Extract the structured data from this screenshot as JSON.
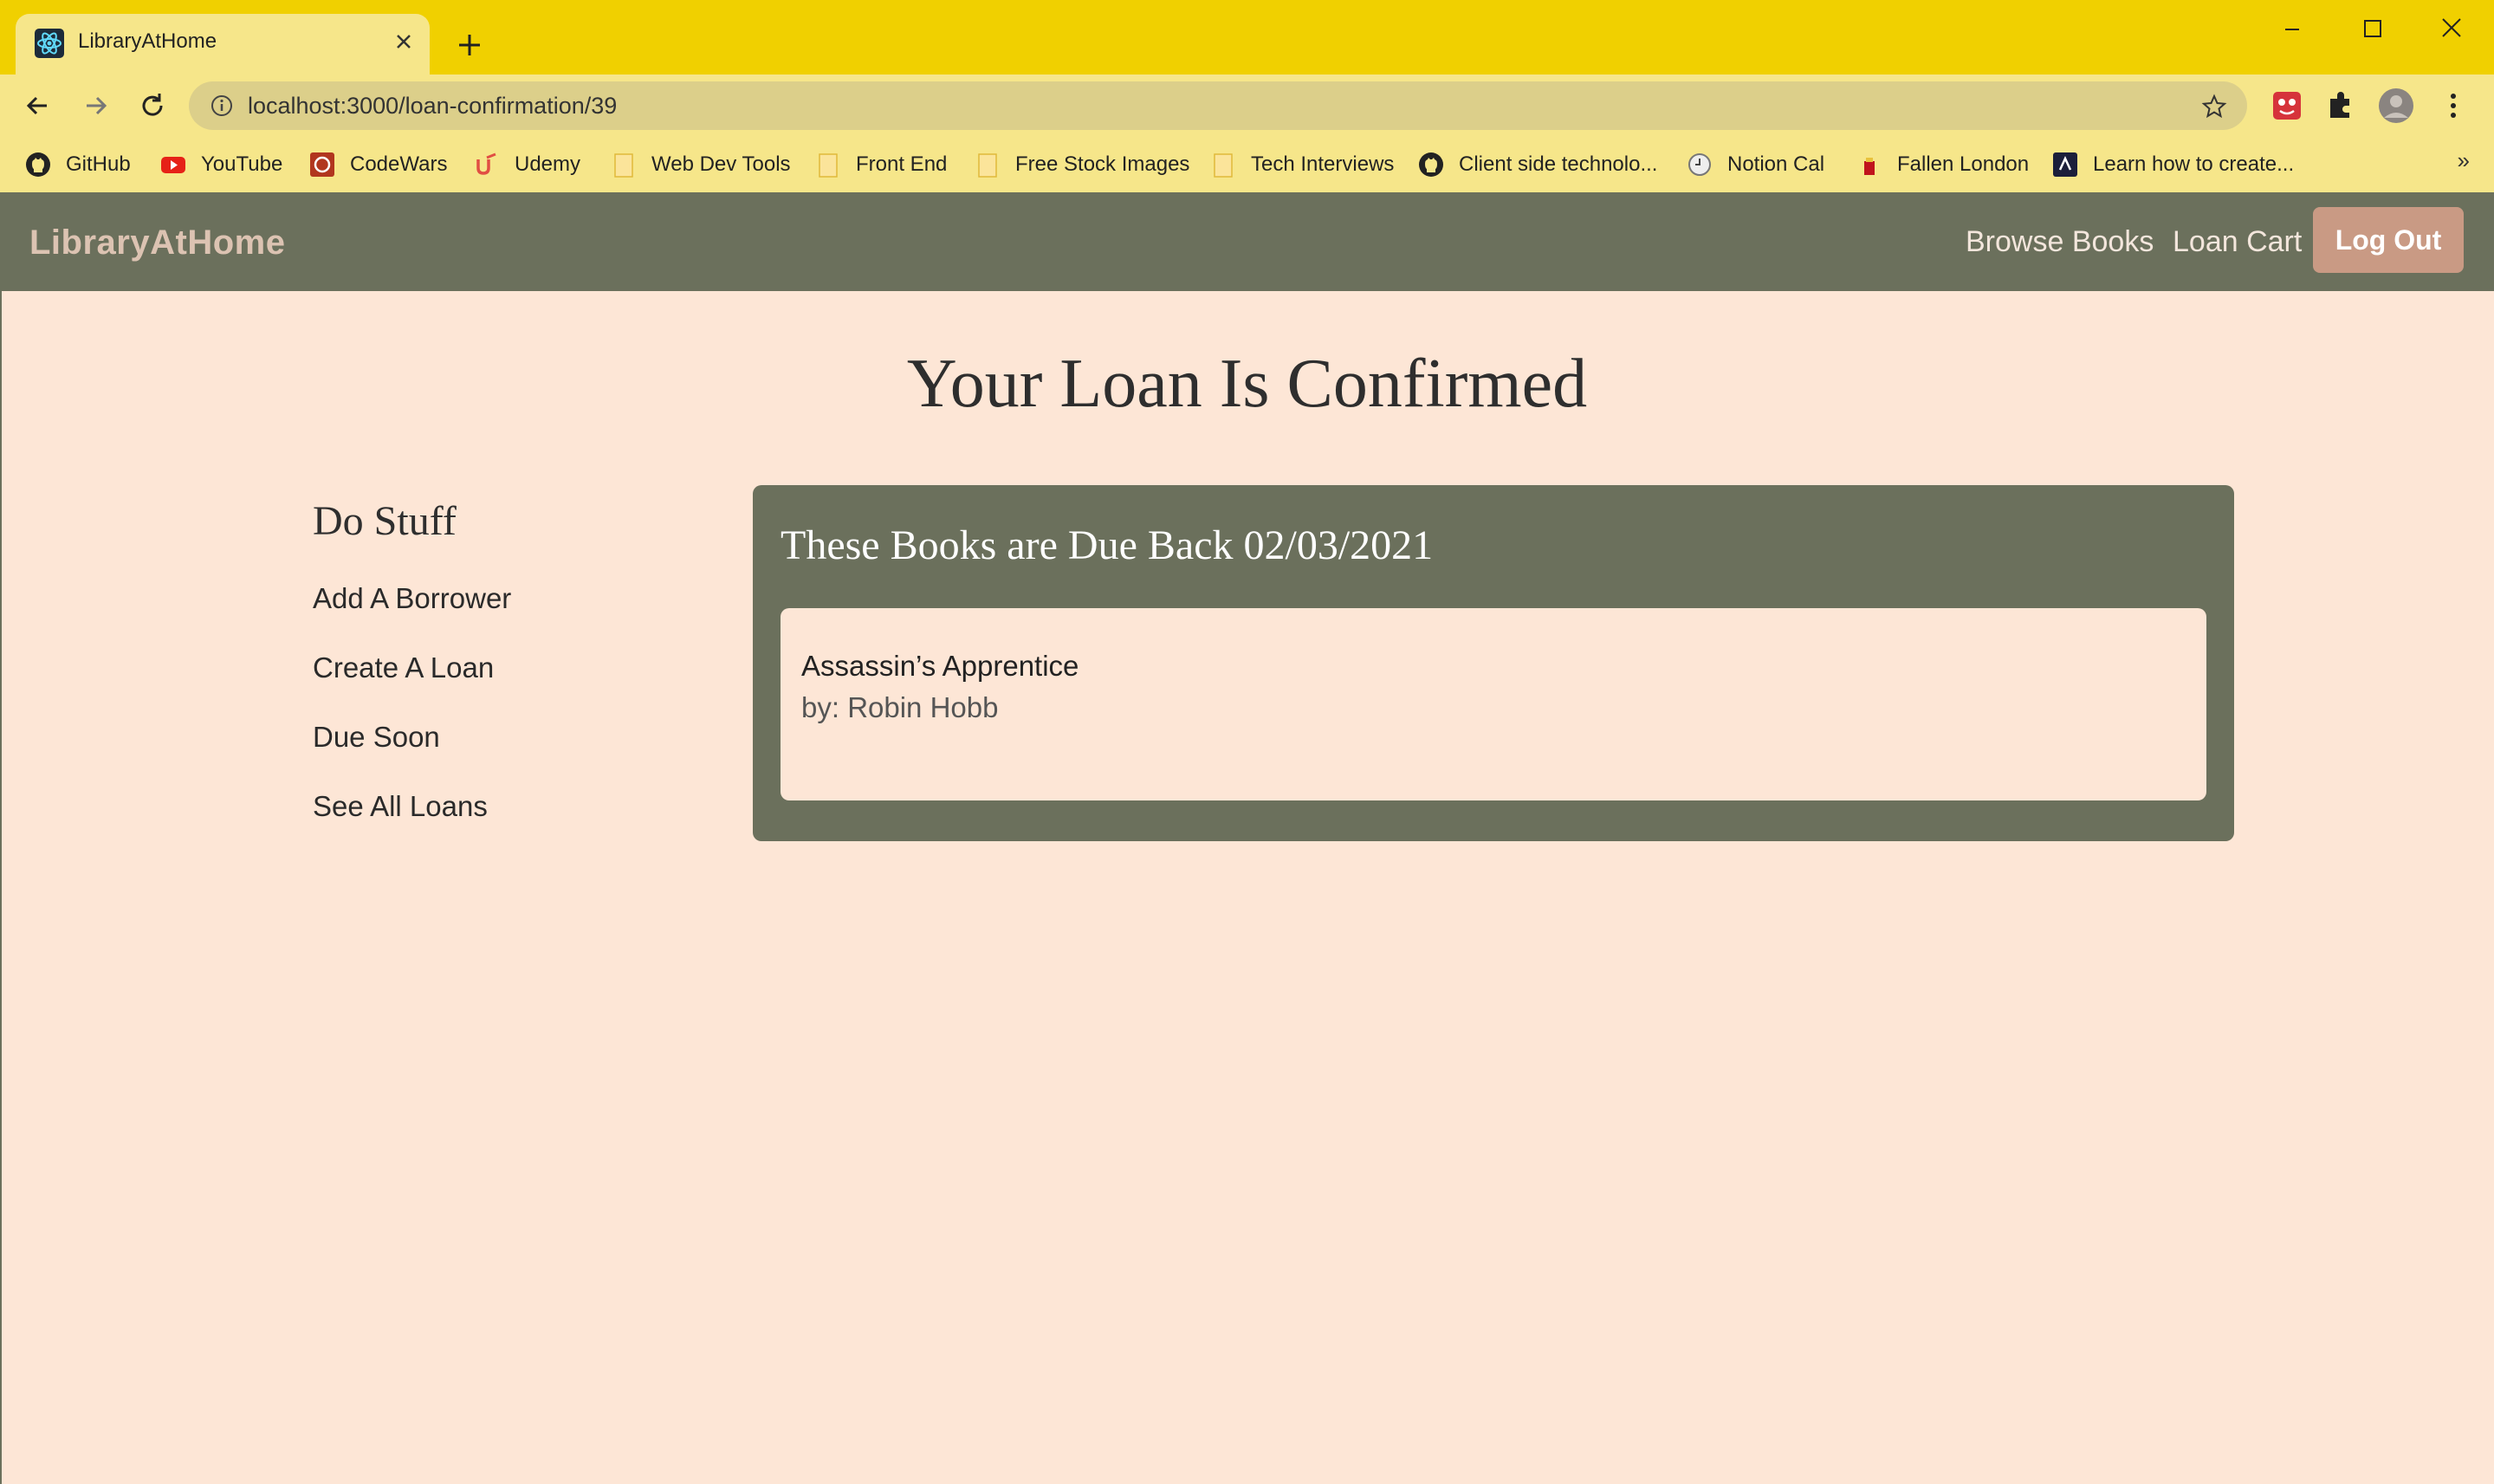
{
  "browser": {
    "tab_title": "LibraryAtHome",
    "url": "localhost:3000/loan-confirmation/39",
    "bookmarks": [
      {
        "label": "GitHub",
        "icon": "github-icon"
      },
      {
        "label": "YouTube",
        "icon": "youtube-icon"
      },
      {
        "label": "CodeWars",
        "icon": "codewars-icon"
      },
      {
        "label": "Udemy",
        "icon": "udemy-icon"
      },
      {
        "label": "Web Dev Tools",
        "icon": "folder-icon"
      },
      {
        "label": "Front End",
        "icon": "folder-icon"
      },
      {
        "label": "Free Stock Images",
        "icon": "folder-icon"
      },
      {
        "label": "Tech Interviews",
        "icon": "folder-icon"
      },
      {
        "label": "Client side technolo...",
        "icon": "github-icon"
      },
      {
        "label": "Notion Cal",
        "icon": "clock-icon"
      },
      {
        "label": "Fallen London",
        "icon": "fallen-london-icon"
      },
      {
        "label": "Learn how to create...",
        "icon": "site-icon"
      }
    ],
    "more_bookmarks": "»"
  },
  "navbar": {
    "brand": "LibraryAtHome",
    "browse_books": "Browse Books",
    "loan_cart": "Loan Cart",
    "log_out": "Log Out"
  },
  "page": {
    "title": "Your Loan Is Confirmed"
  },
  "sidebar": {
    "title": "Do Stuff",
    "items": [
      {
        "label": "Add A Borrower"
      },
      {
        "label": "Create A Loan"
      },
      {
        "label": "Due Soon"
      },
      {
        "label": "See All Loans"
      }
    ]
  },
  "loan": {
    "heading": "These Books are Due Back 02/03/2021",
    "books": [
      {
        "title": "Assassin’s Apprentice",
        "author": "by: Robin Hobb"
      }
    ]
  },
  "colors": {
    "chrome_title": "#f0d000",
    "chrome_toolbar": "#f6e68a",
    "navbar": "#6b705c",
    "page_bg": "#fde6d6",
    "logout_btn": "#c99a84"
  }
}
